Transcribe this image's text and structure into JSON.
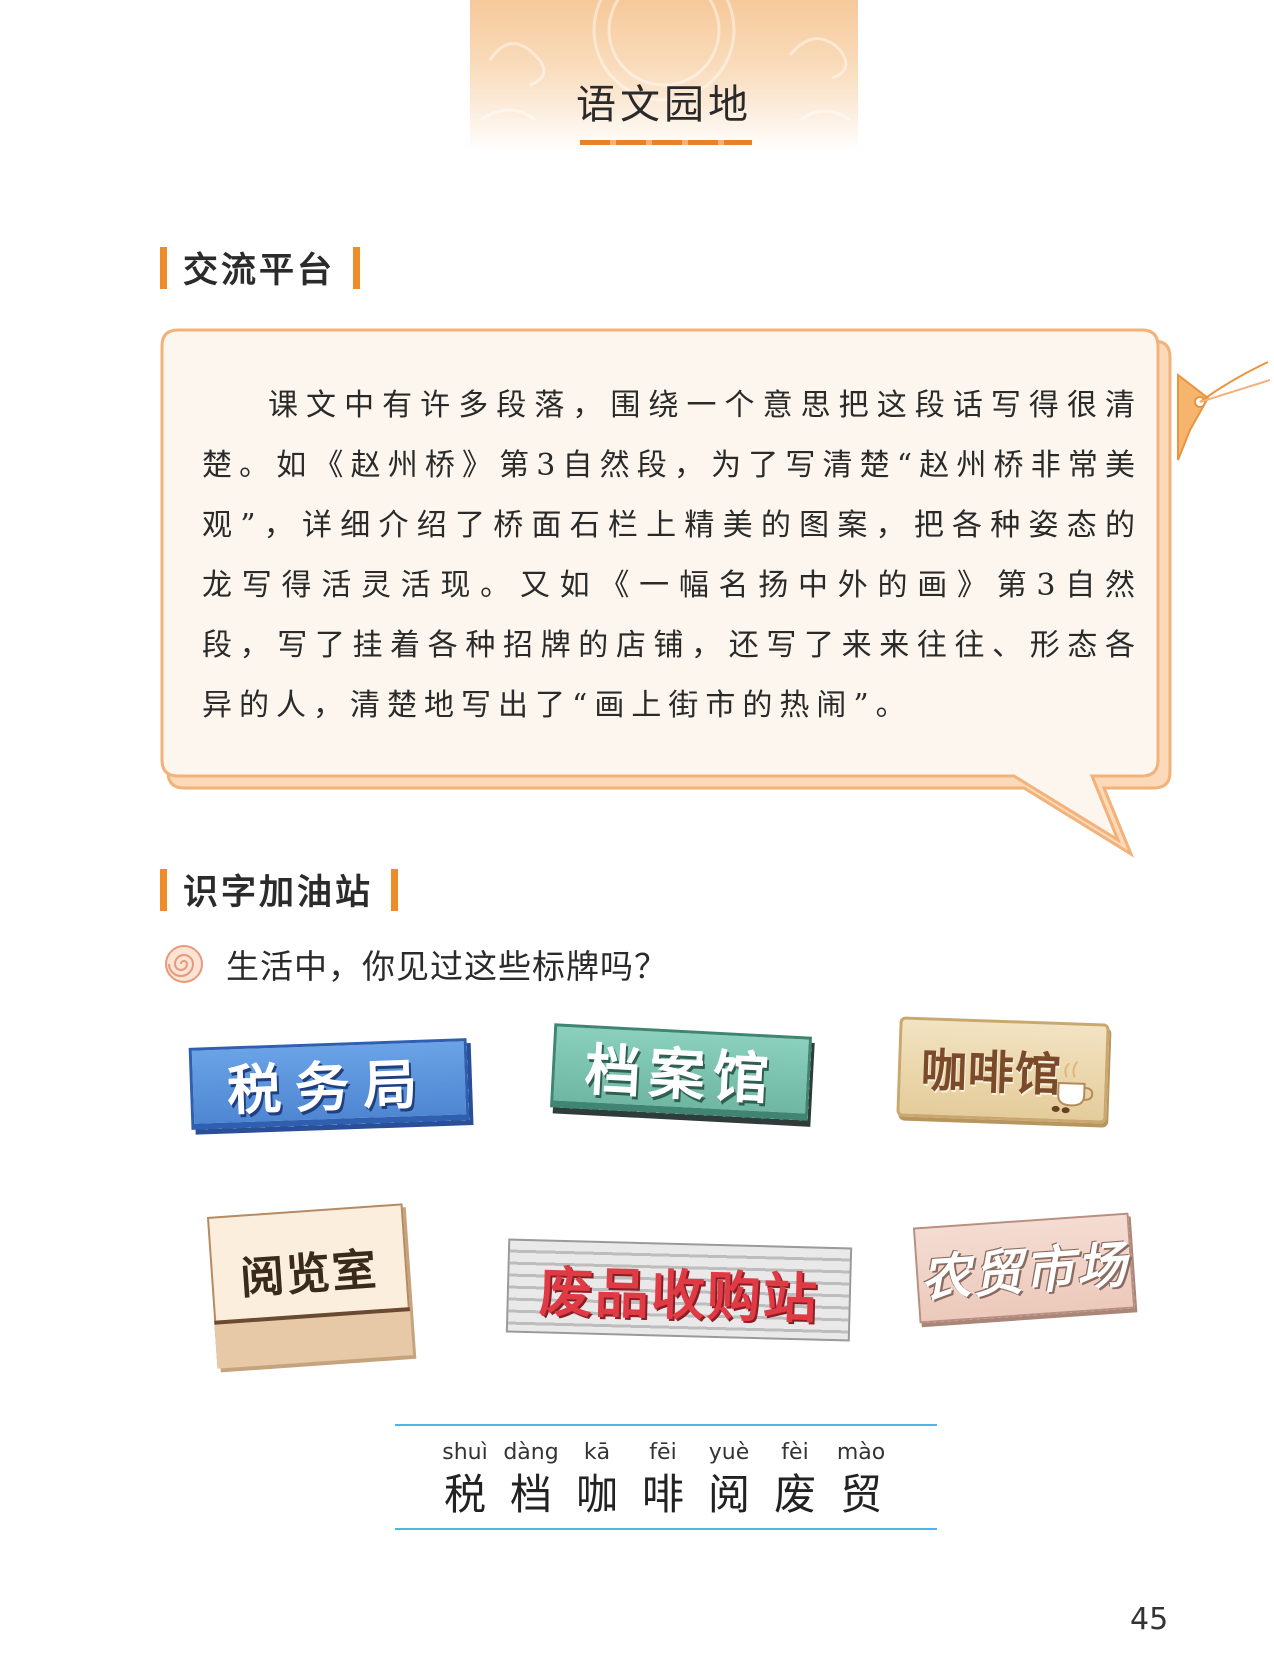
{
  "header": {
    "title": "语文园地"
  },
  "exchange": {
    "heading": "交流平台",
    "paragraph": "课文中有许多段落，围绕一个意思把这段话写得很清楚。如《赵州桥》第3自然段，为了写清楚“赵州桥非常美观”，详细介绍了桥面石栏上精美的图案，把各种姿态的龙写得活灵活现。又如《一幅名扬中外的画》第3自然段，写了挂着各种招牌的店铺，还写了来来往往、形态各异的人，清楚地写出了“画上街市的热闹”。"
  },
  "literacy": {
    "heading": "识字加油站",
    "question": "生活中，你见过这些标牌吗？",
    "signs": {
      "tax": "税务局",
      "archive": "档案馆",
      "cafe": "咖啡馆",
      "reading": "阅览室",
      "waste": "废品收购站",
      "market": "农贸市场"
    },
    "characters": [
      {
        "pinyin": "shuì",
        "char": "税"
      },
      {
        "pinyin": "dàng",
        "char": "档"
      },
      {
        "pinyin": "kā",
        "char": "咖"
      },
      {
        "pinyin": "fēi",
        "char": "啡"
      },
      {
        "pinyin": "yuè",
        "char": "阅"
      },
      {
        "pinyin": "fèi",
        "char": "废"
      },
      {
        "pinyin": "mào",
        "char": "贸"
      }
    ]
  },
  "page_number": "45"
}
